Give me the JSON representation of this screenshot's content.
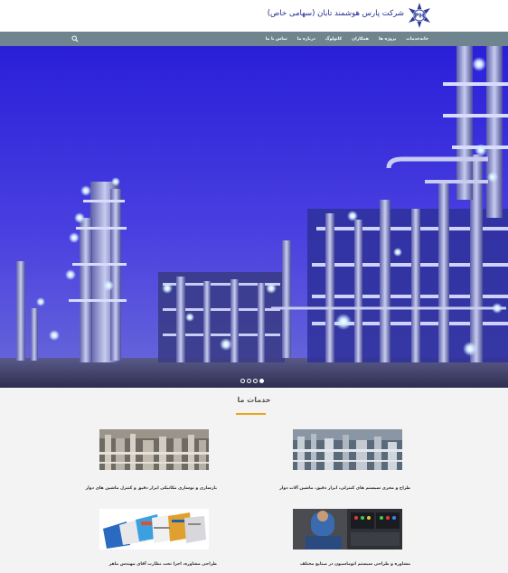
{
  "header": {
    "company_name": "شرکت پارس هوشمند تابان (سهامی خاص)"
  },
  "nav": {
    "items": [
      {
        "label": "خانه"
      },
      {
        "label": "خدمات"
      },
      {
        "label": "پروژه ها"
      },
      {
        "label": "همکاران"
      },
      {
        "label": "کاتولوگ"
      },
      {
        "label": "درباره ما"
      },
      {
        "label": "تماس با ما"
      }
    ]
  },
  "slider": {
    "dots": 4,
    "active_index": 3
  },
  "services": {
    "title": "خدمات ما",
    "cards": [
      {
        "caption": "طراح و مجری سیستم های کنترلی، ابزار دقیق، ماشین آلات دوار"
      },
      {
        "caption": "بازسازی و نوسازی مکانیکی ابزار دقیق و کنترل ماشین های دوار"
      },
      {
        "caption": "مشاوره و طراحی سیستم اتوماسیون در صنایع مختلف"
      },
      {
        "caption": "طراحی مشاوره، اجرا تحت نظارت آقای مهندس ماهر"
      }
    ]
  },
  "colors": {
    "nav_bg": "#6e8590",
    "accent": "#e8a41b",
    "brand_blue": "#1d2a8c"
  }
}
